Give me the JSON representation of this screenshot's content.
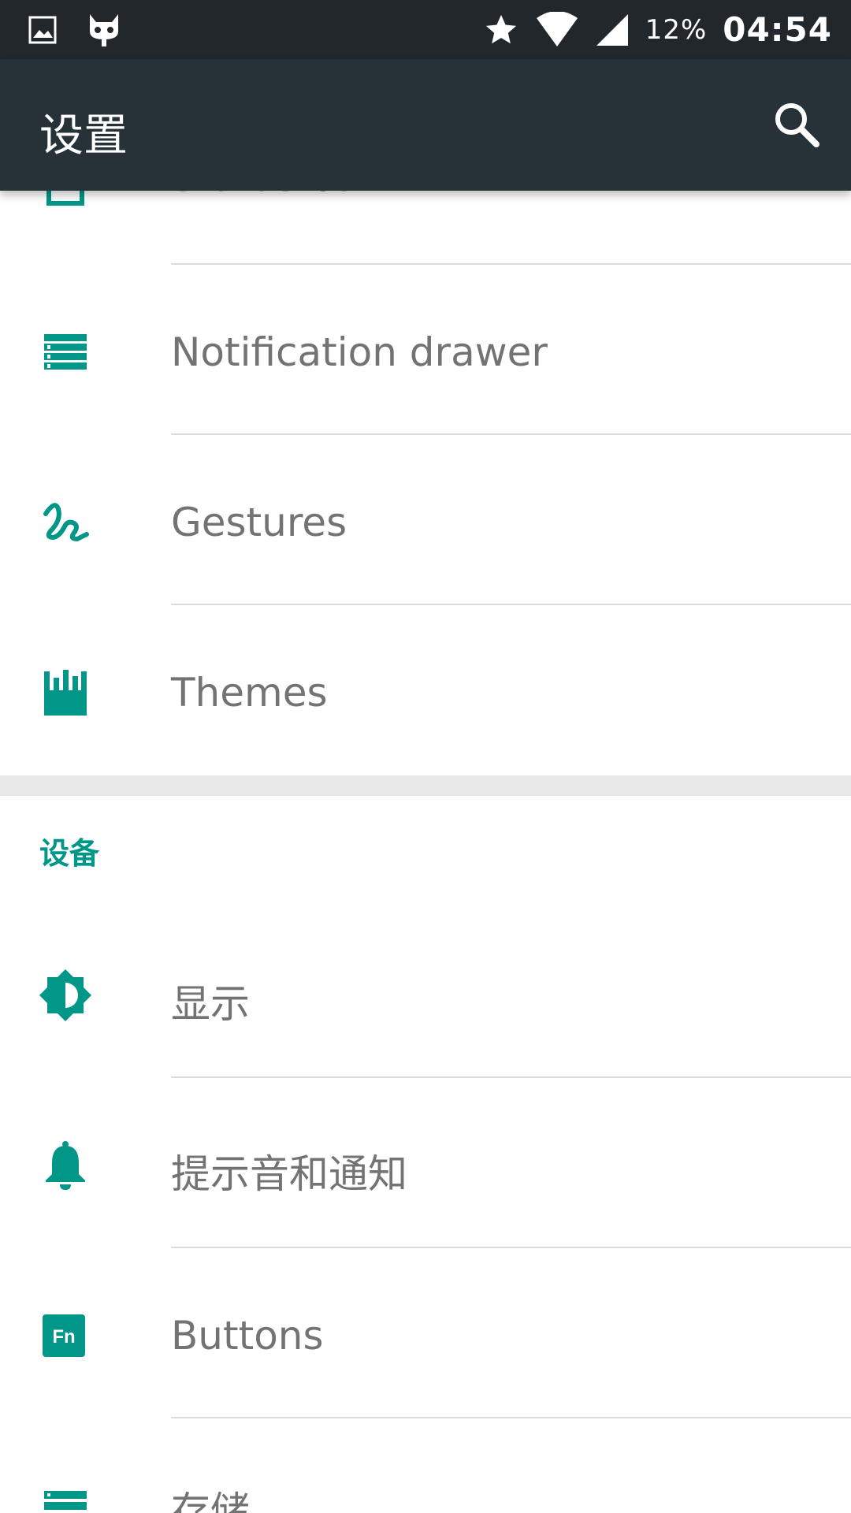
{
  "status_bar": {
    "battery": "12%",
    "time": "04:54",
    "icons": [
      "image-icon",
      "cyanogen-icon",
      "star-icon",
      "wifi-icon",
      "signal-icon"
    ]
  },
  "toolbar": {
    "title": "设置",
    "search_icon": "search-icon"
  },
  "top_section": {
    "partial_item_label": "Status bar",
    "items": [
      {
        "label": "Notification drawer",
        "icon": "notification-drawer-icon"
      },
      {
        "label": "Gestures",
        "icon": "gestures-icon"
      },
      {
        "label": "Themes",
        "icon": "themes-icon"
      }
    ]
  },
  "device_section": {
    "header": "设备",
    "items": [
      {
        "label": "显示",
        "icon": "display-brightness-icon"
      },
      {
        "label": "提示音和通知",
        "icon": "bell-icon"
      },
      {
        "label": "Buttons",
        "icon": "fn-buttons-icon"
      },
      {
        "label": "存储",
        "icon": "storage-icon"
      }
    ]
  },
  "colors": {
    "accent": "#009688",
    "toolbar": "#263238",
    "status_bar": "#21272b",
    "text": "#737373"
  }
}
